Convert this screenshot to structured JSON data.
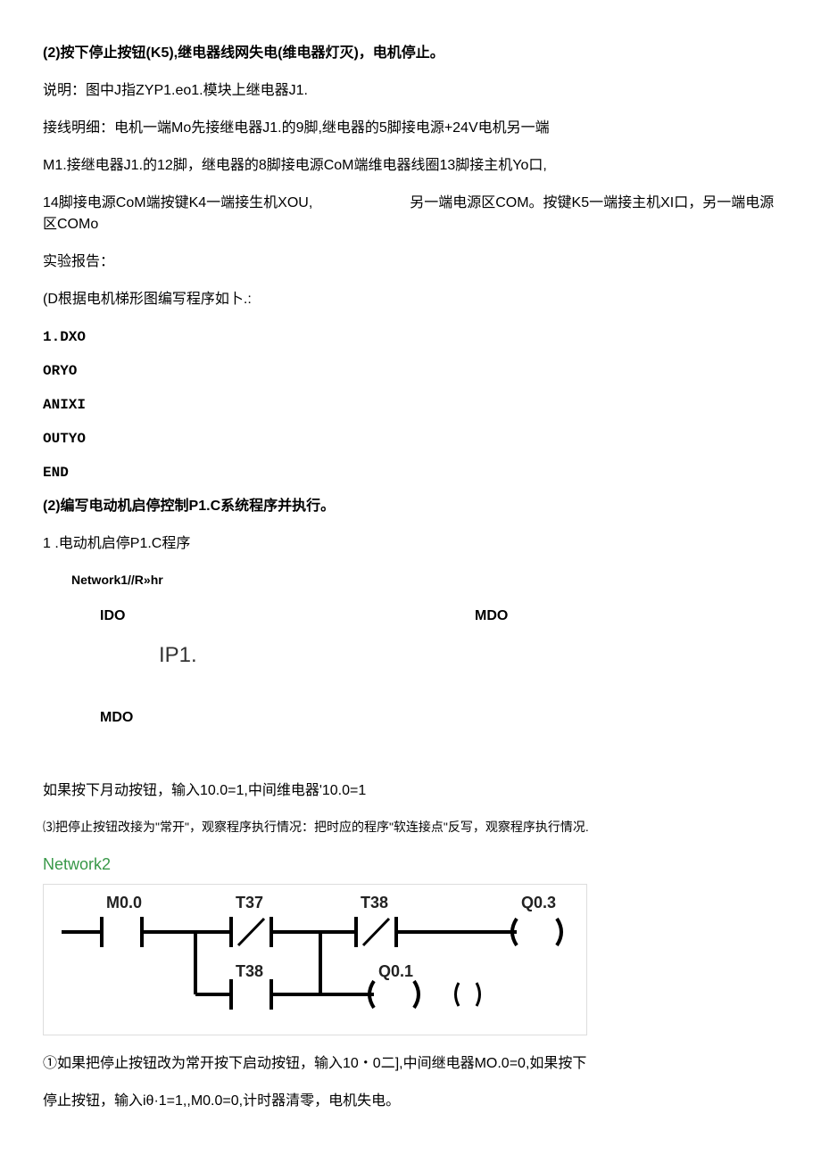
{
  "p1": "(2)按下停止按钮(K5),继电器线网失电(维电器灯灭)，电机停止。",
  "p2": "说明：图中J指ZYP1.eo1.模块上继电器J1.",
  "p3": "接线明细：电机一端Mo先接继电器J1.的9脚,继电器的5脚接电源+24V电机另一端",
  "p4": "M1.接继电器J1.的12脚，继电器的8脚接电源CoM端维电器线圈13脚接主机Yo口,",
  "p5a": "14脚接电源CoM端按键K4一端接生机XOU,",
  "p5b": "另一端电源区COM。按键K5一端接主机XI口，另一端电源区COMo",
  "p6": "实验报告：",
  "p7": "(D根据电机梯形图编写程序如卜.:",
  "code1": "1.DXO",
  "code2": "ORYO",
  "code3": "ANIXI",
  "code4": "OUTYO",
  "code5": "END",
  "p8": "(2)编写电动机启停控制P1.C系统程序并执行。",
  "p9": "1 .电动机启停P1.C程序",
  "network1": "Network1//R»hr",
  "ido": "IDO",
  "mdo1": "MDO",
  "ip1": "IP1.",
  "mdo2": "MDO",
  "p10": "如果按下月动按钮，输入10.0=1,中间维电器'10.0=1",
  "p11": "⑶把停止按钮改接为\"常开\"，观察程序执行情况：把时应的程序\"软连接点\"反写，观察程序执行情况.",
  "network2": "Network2",
  "ladder": {
    "m00": "M0.0",
    "t37": "T37",
    "t38a": "T38",
    "q03": "Q0.3",
    "t38b": "T38",
    "q01": "Q0.1"
  },
  "p12": "①如果把停止按钮改为常开按下启动按钮，输入10・0二],中间继电器MO.0=0,如果按下",
  "p13": "停止按钮，输入iθ·1=1,,M0.0=0,计时器清零，电机失电。"
}
